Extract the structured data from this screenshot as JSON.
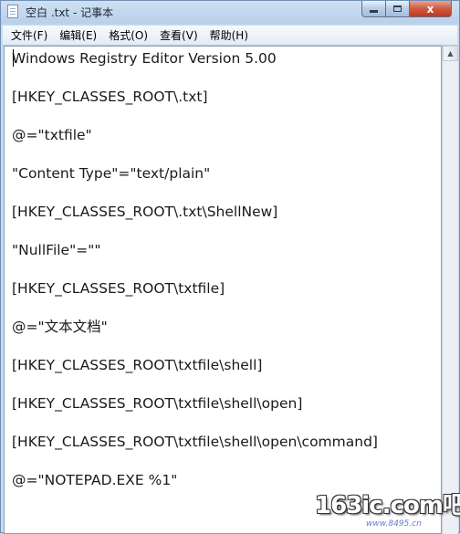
{
  "window": {
    "title": "空白 .txt - 记事本"
  },
  "controls": {
    "close_glyph": "x"
  },
  "menu": {
    "items": [
      {
        "label": "文件(F)"
      },
      {
        "label": "编辑(E)"
      },
      {
        "label": "格式(O)"
      },
      {
        "label": "查看(V)"
      },
      {
        "label": "帮助(H)"
      }
    ]
  },
  "editor": {
    "lines": [
      "Windows Registry Editor Version 5.00",
      "[HKEY_CLASSES_ROOT\\.txt]",
      "@=\"txtfile\"",
      "\"Content Type\"=\"text/plain\"",
      "[HKEY_CLASSES_ROOT\\.txt\\ShellNew]",
      "\"NullFile\"=\"\"",
      "[HKEY_CLASSES_ROOT\\txtfile]",
      "@=\"文本文档\"",
      "[HKEY_CLASSES_ROOT\\txtfile\\shell]",
      "[HKEY_CLASSES_ROOT\\txtfile\\shell\\open]",
      "[HKEY_CLASSES_ROOT\\txtfile\\shell\\open\\command]",
      "@=\"NOTEPAD.EXE %1\""
    ]
  },
  "watermark": {
    "text": "163ic.com",
    "suffix": "吧",
    "url": "www.8495.cn"
  }
}
